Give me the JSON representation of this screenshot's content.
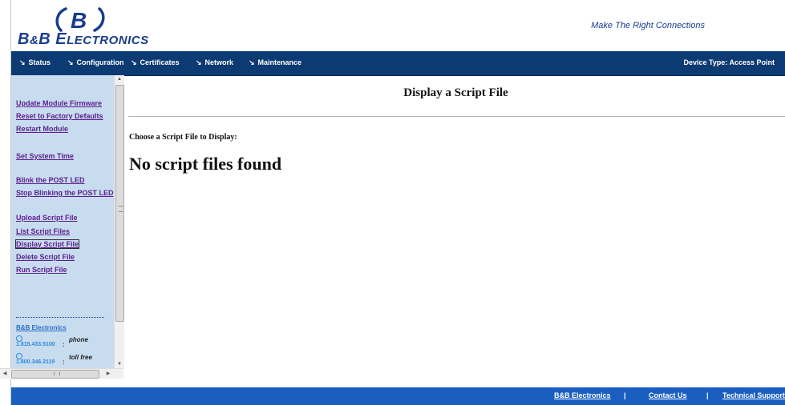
{
  "brand": {
    "logo_letter": "B",
    "logo_text_big_1": "B",
    "logo_text_amp": "&",
    "logo_text_big_2": "B ",
    "logo_text_big_3": "E",
    "logo_text_small": "LECTRONICS",
    "tagline": "Make The Right Connections",
    "color_primary": "#1a3c8c"
  },
  "nav": {
    "items": [
      {
        "label": "Status"
      },
      {
        "label": "Configuration"
      },
      {
        "label": "Certificates"
      },
      {
        "label": "Network"
      },
      {
        "label": "Maintenance"
      }
    ],
    "device_type": "Device Type: Access Point",
    "background": "#0c3a72"
  },
  "sidebar": {
    "links": [
      {
        "label": "Update Module Firmware"
      },
      {
        "label": "Reset to Factory Defaults"
      },
      {
        "label": "Restart Module"
      },
      {
        "label": "Set System Time"
      },
      {
        "label": "Blink the POST LED"
      },
      {
        "label": "Stop Blinking the POST LED"
      },
      {
        "label": "Upload Script File"
      },
      {
        "label": "List Script Files"
      },
      {
        "label": "Display Script File"
      },
      {
        "label": "Delete Script File"
      },
      {
        "label": "Run Script File"
      }
    ],
    "active_link": "Display Script File",
    "company_link": "B&B Electronics",
    "contacts": [
      {
        "number": "1.815.433.5100",
        "separator": ":",
        "kind": "phone"
      },
      {
        "number": "1.800.346.3119",
        "separator": ":",
        "kind": "toll free"
      }
    ],
    "background": "#c8dcf0"
  },
  "scrollbars": {
    "vertical_up": "▲",
    "vertical_down": "▼",
    "horizontal_left": "◀",
    "horizontal_right": "▶",
    "horizontal_grip": "III"
  },
  "main": {
    "title": "Display a Script File",
    "choose_label": "Choose a Script File to Display:",
    "empty_message": "No script files found"
  },
  "footer": {
    "links": [
      {
        "label": "B&B Electronics"
      },
      {
        "label": "Contact Us"
      },
      {
        "label": "Technical Support"
      }
    ],
    "separator": "|",
    "background": "#1a5fbf"
  }
}
